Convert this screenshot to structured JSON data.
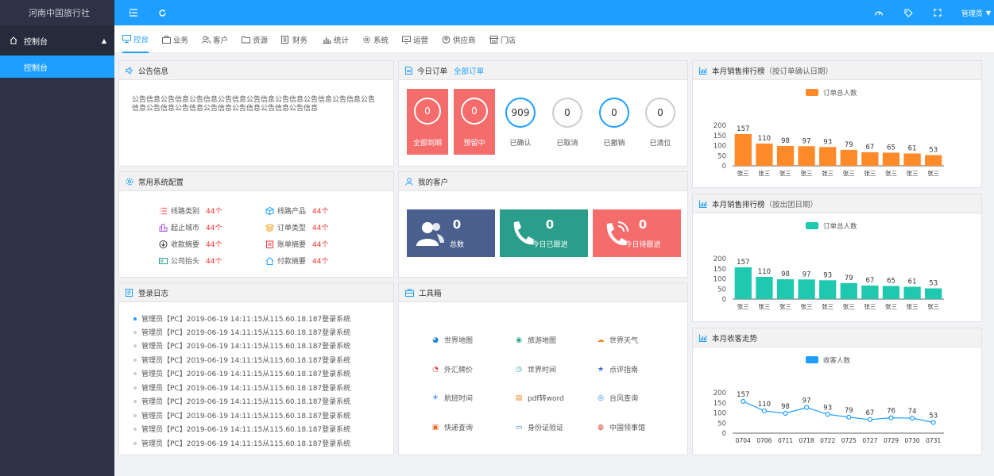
{
  "app": {
    "title": "河南中国旅行社"
  },
  "sidebar": {
    "group_label": "控制台",
    "item_label": "控制台"
  },
  "topbar": {
    "user": "管理员"
  },
  "tabs": [
    "控台",
    "业务",
    "客户",
    "资源",
    "财务",
    "统计",
    "系统",
    "运营",
    "供应商",
    "门店"
  ],
  "notice": {
    "title": "公告信息",
    "text": "公告信息公告信息公告信息公告信息公告信息公告信息公告信息公告信息公告信息公告信息公告信息公告信息公告信息公告信息公告信息"
  },
  "orders": {
    "title": "今日订单",
    "link": "全部订单",
    "boxes": [
      {
        "value": "0",
        "label": "全部到期"
      },
      {
        "value": "0",
        "label": "预留中"
      }
    ],
    "stats": [
      {
        "value": "909",
        "label": "已确认",
        "color": "#1e9fff"
      },
      {
        "value": "0",
        "label": "已取消",
        "color": "#cccccc"
      },
      {
        "value": "0",
        "label": "已撤销",
        "color": "#1e9fff"
      },
      {
        "value": "0",
        "label": "已清位",
        "color": "#cccccc"
      }
    ]
  },
  "config": {
    "title": "常用系统配置",
    "items": [
      {
        "label": "线路类别",
        "count": "44个",
        "icon": "list-icon"
      },
      {
        "label": "线路产品",
        "count": "44个",
        "icon": "cube-icon"
      },
      {
        "label": "起止城市",
        "count": "44个",
        "icon": "city-icon"
      },
      {
        "label": "订单类型",
        "count": "44个",
        "icon": "layers-icon"
      },
      {
        "label": "收款摘要",
        "count": "44个",
        "icon": "download-icon"
      },
      {
        "label": "账单摘要",
        "count": "44个",
        "icon": "clipboard-icon"
      },
      {
        "label": "公司抬头",
        "count": "44个",
        "icon": "card-icon"
      },
      {
        "label": "付款摘要",
        "count": "44个",
        "icon": "home-icon"
      }
    ]
  },
  "customers": {
    "title": "我的客户",
    "cards": [
      {
        "value": "0",
        "label": "总数",
        "color": "#4b5f8e"
      },
      {
        "value": "0",
        "label": "今日已跟进",
        "color": "#2a9e8b"
      },
      {
        "value": "0",
        "label": "今日待跟进",
        "color": "#f56c6c"
      }
    ]
  },
  "logs": {
    "title": "登录日志",
    "entries": [
      "管理员【PC】2019-06-19 14:11:15从115.60.18.187登录系统",
      "管理员【PC】2019-06-19 14:11:15从115.60.18.187登录系统",
      "管理员【PC】2019-06-19 14:11:15从115.60.18.187登录系统",
      "管理员【PC】2019-06-19 14:11:15从115.60.18.187登录系统",
      "管理员【PC】2019-06-19 14:11:15从115.60.18.187登录系统",
      "管理员【PC】2019-06-19 14:11:15从115.60.18.187登录系统",
      "管理员【PC】2019-06-19 14:11:15从115.60.18.187登录系统",
      "管理员【PC】2019-06-19 14:11:15从115.60.18.187登录系统",
      "管理员【PC】2019-06-19 14:11:15从115.60.18.187登录系统",
      "管理员【PC】2019-06-19 14:11:15从115.60.18.187登录系统"
    ]
  },
  "tools": {
    "title": "工具箱",
    "items": [
      {
        "label": "世界地图",
        "color": "#1e7fd9",
        "glyph": "◕"
      },
      {
        "label": "旅游地图",
        "color": "#2aa58a",
        "glyph": "◉"
      },
      {
        "label": "世界天气",
        "color": "#f08a24",
        "glyph": "☁"
      },
      {
        "label": "外汇牌价",
        "color": "#d33a2c",
        "glyph": "◔"
      },
      {
        "label": "世界时间",
        "color": "#1aa3a3",
        "glyph": "◷"
      },
      {
        "label": "点评指南",
        "color": "#4a6fd1",
        "glyph": "★"
      },
      {
        "label": "航班时间",
        "color": "#1e7fd9",
        "glyph": "✈"
      },
      {
        "label": "pdf转word",
        "color": "#f08a24",
        "glyph": "▤"
      },
      {
        "label": "台风查询",
        "color": "#1e7fd9",
        "glyph": "◎"
      },
      {
        "label": "快递查询",
        "color": "#e56a2c",
        "glyph": "▣"
      },
      {
        "label": "身份证验证",
        "color": "#1e7fd9",
        "glyph": "▭"
      },
      {
        "label": "中国领事馆",
        "color": "#d33a2c",
        "glyph": "◍"
      }
    ]
  },
  "chart_data": [
    {
      "type": "bar",
      "title": "本月销售排行榜",
      "subtitle": "（按订单确认日期）",
      "categories": [
        "张三",
        "张三",
        "张三",
        "张三",
        "张三",
        "张三",
        "张三",
        "张三",
        "张三",
        "张三"
      ],
      "series": [
        {
          "name": "订单总人数",
          "values": [
            157,
            110,
            98,
            97,
            93,
            79,
            67,
            65,
            61,
            53
          ]
        }
      ],
      "ylim": [
        0,
        200
      ],
      "yticks": [
        "200",
        "150",
        "100",
        "50",
        "0"
      ],
      "color": "#ff8a2a",
      "legend": "top-center"
    },
    {
      "type": "bar",
      "title": "本月销售排行榜",
      "subtitle": "（按出团日期）",
      "categories": [
        "张三",
        "张三",
        "张三",
        "张三",
        "张三",
        "张三",
        "张三",
        "张三",
        "张三",
        "张三"
      ],
      "series": [
        {
          "name": "订单总人数",
          "values": [
            157,
            110,
            98,
            97,
            93,
            79,
            67,
            65,
            61,
            53
          ]
        }
      ],
      "ylim": [
        0,
        200
      ],
      "yticks": [
        "200",
        "150",
        "100",
        "50",
        "0"
      ],
      "color": "#1ec9b0",
      "legend": "top-center"
    },
    {
      "type": "line",
      "title": "本月收客走势",
      "subtitle": "",
      "categories": [
        "0704",
        "0706",
        "0711",
        "0718",
        "0722",
        "0725",
        "0727",
        "0729",
        "0730",
        "0731"
      ],
      "series": [
        {
          "name": "收客人数",
          "values": [
            157,
            110,
            98,
            127,
            93,
            79,
            67,
            76,
            74,
            53
          ]
        }
      ],
      "labels": [
        "157",
        "110",
        "98",
        "97",
        "93",
        "79",
        "67",
        "76",
        "74",
        "53"
      ],
      "ylim": [
        0,
        200
      ],
      "yticks": [
        "200",
        "150",
        "100",
        "50",
        "0"
      ],
      "color": "#1e9fff",
      "legend": "top-center"
    }
  ]
}
